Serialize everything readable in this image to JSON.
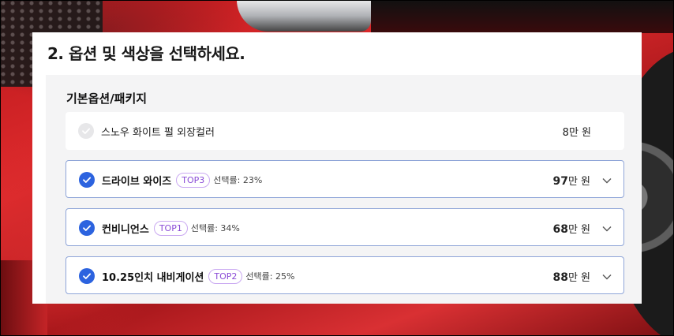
{
  "section": {
    "title": "2. 옵션 및 색상을 선택하세요.",
    "group_title": "기본옵션/패키지"
  },
  "options": [
    {
      "name": "스노우 화이트 펄 외장컬러",
      "price_num": "8",
      "price_unit": "만 원",
      "selected": false,
      "icon": "check-circle-icon"
    },
    {
      "name": "드라이브 와이즈",
      "badge": "TOP3",
      "rate": "선택률: 23%",
      "price_num": "97",
      "price_unit": "만 원",
      "selected": true,
      "icon": "check-circle-icon"
    },
    {
      "name": "컨비니언스",
      "badge": "TOP1",
      "rate": "선택률: 34%",
      "price_num": "68",
      "price_unit": "만 원",
      "selected": true,
      "icon": "check-circle-icon"
    },
    {
      "name": "10.25인치 내비게이션",
      "badge": "TOP2",
      "rate": "선택률: 25%",
      "price_num": "88",
      "price_unit": "만 원",
      "selected": true,
      "icon": "check-circle-icon"
    }
  ],
  "colors": {
    "accent": "#2c63df",
    "badge": "#8a4bd6",
    "selected_border": "#8fa5d8"
  }
}
